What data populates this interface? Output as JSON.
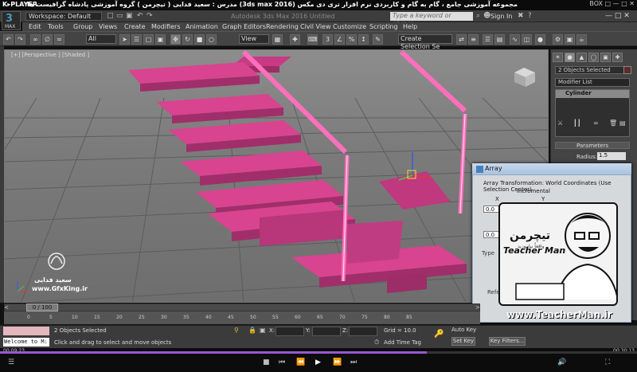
{
  "player": {
    "logo": "K▸PLAYER",
    "title": "مجموعه آموزشی جامع ، گام به گام و کاربردی نرم افزار تری دی مکس (3ds max 2016) مدرس : سعید فدایی ( تیچرمن ) گروه آموزشی پادشاه گرافیست ها",
    "window_buttons": "BOX □ — □ ✕",
    "current_time": "00:09:23",
    "total_time": "00:30:13",
    "progress": 0.67
  },
  "max": {
    "logo_text": "MAX",
    "workspace": "Workspace: Default",
    "app_title": "Autodesk 3ds Max 2016    Untitled",
    "search_placeholder": "Type a keyword or phrase",
    "sign_in": "Sign In",
    "menu": [
      "Edit",
      "Tools",
      "Group",
      "Views",
      "Create",
      "Modifiers",
      "Animation",
      "Graph Editors",
      "Rendering",
      "Civil View",
      "Customize",
      "Scripting",
      "Help"
    ],
    "toolbar": {
      "filter": "All",
      "ref_coord": "View",
      "selection_set": "Create Selection Se"
    }
  },
  "viewport": {
    "label": "[+] [Perspective ] [Shaded ]",
    "watermark_name": "سعید فدایی",
    "watermark_site": "www.GfxKing.ir",
    "stair_color": "#d8448f",
    "rail_color": "#ff5fb0"
  },
  "command_panel": {
    "selection": "2 Objects Selected",
    "modifier_list": "Modifier List",
    "stack_item": "Cylinder",
    "rollout": "Parameters",
    "radius_label": "Radius:",
    "radius_value": "1.5"
  },
  "array_dialog": {
    "title": "Array",
    "transform": "Array Transformation: World Coordinates (Use Selection Center)",
    "incremental": "Incremental",
    "x_label": "X",
    "y_label": "Y",
    "move_x": "0.0",
    "move_y": "0.0",
    "rotate_x": "0.0",
    "type_label": "Type",
    "reference_label": "Referen"
  },
  "teacherman": {
    "persian_logo": "تیچرمن",
    "persian_tagline": "واقعاً بیاموزید",
    "brand": "Teacher Man",
    "url": "www.TeacherMan.ir"
  },
  "timeline": {
    "position": "0 / 100",
    "ticks": [
      "0",
      "5",
      "10",
      "15",
      "20",
      "25",
      "30",
      "35",
      "40",
      "45",
      "50",
      "55",
      "60",
      "65",
      "70",
      "75",
      "80",
      "85"
    ]
  },
  "status": {
    "selected": "2 Objects Selected",
    "help": "Click and drag to select and move objects",
    "listener": "Welcome to M:",
    "x_label": "X:",
    "y_label": "Y:",
    "z_label": "Z:",
    "grid": "Grid = 10.0",
    "add_time_tag": "Add Time Tag",
    "auto_key": "Auto Key",
    "set_key": "Set Key",
    "key_filters": "Key Filters..."
  }
}
